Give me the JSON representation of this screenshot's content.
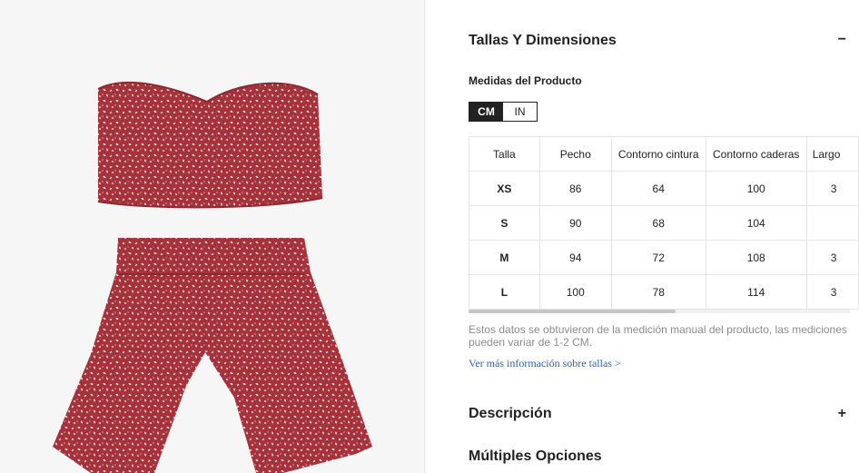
{
  "sizes_section": {
    "title": "Tallas Y Dimensiones",
    "toggle": "−",
    "subtitle": "Medidas del Producto",
    "units": [
      "CM",
      "IN"
    ],
    "active_unit": "CM",
    "table": {
      "headers": [
        "Talla",
        "Pecho",
        "Contorno cintura",
        "Contorno caderas",
        "Largo"
      ],
      "rows": [
        [
          "XS",
          "86",
          "64",
          "100",
          "3"
        ],
        [
          "S",
          "90",
          "68",
          "104",
          ""
        ],
        [
          "M",
          "94",
          "72",
          "108",
          "3"
        ],
        [
          "L",
          "100",
          "78",
          "114",
          "3"
        ]
      ]
    },
    "note": "Estos datos se obtuvieron de la medición manual del producto, las mediciones pueden variar de 1-2 CM.",
    "more_link": "Ver más información sobre tallas >"
  },
  "description_section": {
    "title": "Descripción",
    "toggle": "+"
  },
  "options_section": {
    "title": "Múltiples Opciones"
  },
  "colors": {
    "fabric": "#a6323c",
    "fabric_dark": "#8e2830",
    "dot": "#f4e6e6",
    "background": "#f6f6f6",
    "text": "#222222",
    "muted": "#8c8c8c",
    "link": "#2c63b2",
    "border": "#e5e5e5"
  }
}
